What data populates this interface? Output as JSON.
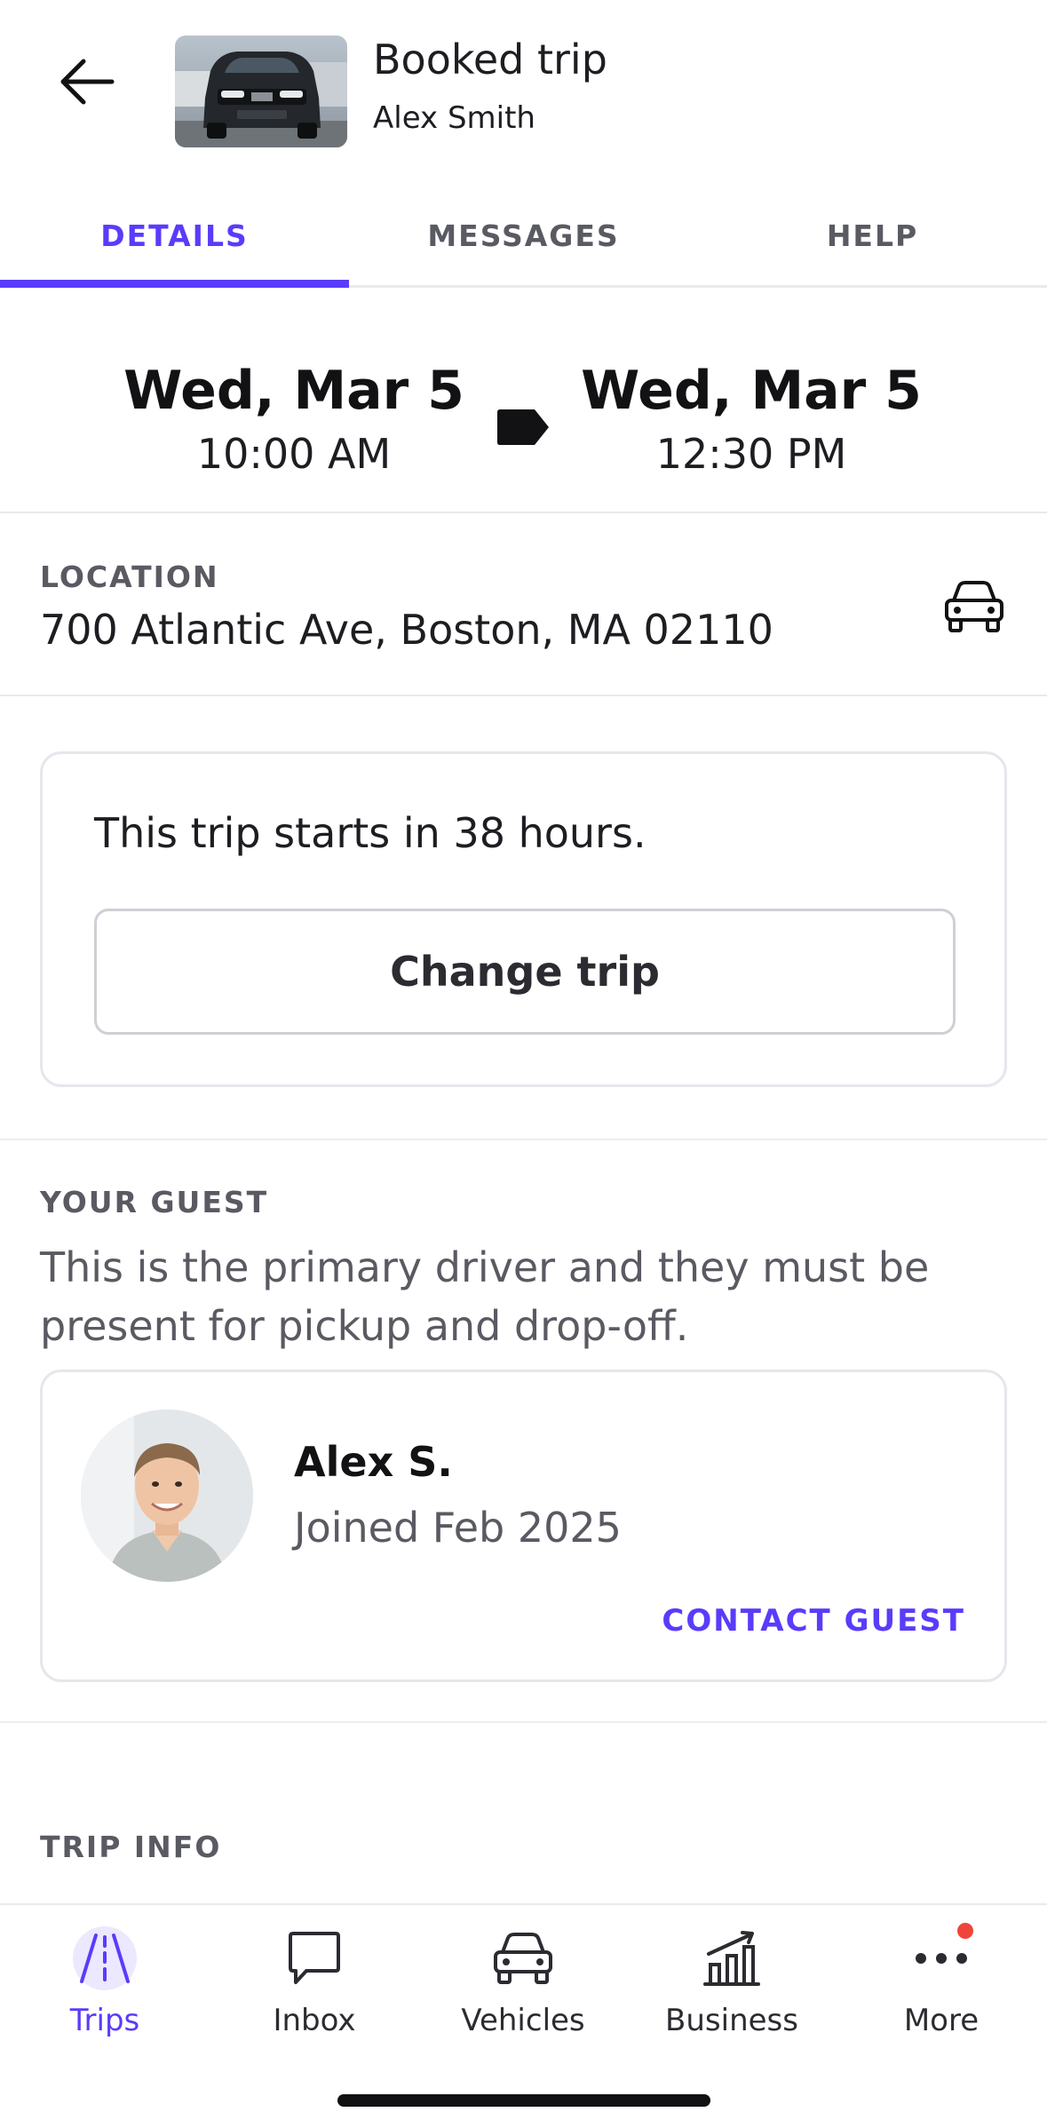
{
  "header": {
    "title": "Booked trip",
    "subtitle": "Alex Smith"
  },
  "tabs": [
    {
      "label": "DETAILS",
      "active": true
    },
    {
      "label": "MESSAGES",
      "active": false
    },
    {
      "label": "HELP",
      "active": false
    }
  ],
  "trip_dates": {
    "start": {
      "day": "Wed, Mar 5",
      "time": "10:00 AM"
    },
    "end": {
      "day": "Wed, Mar 5",
      "time": "12:30 PM"
    }
  },
  "location": {
    "label": "LOCATION",
    "address": "700 Atlantic Ave, Boston, MA 02110"
  },
  "trip_status": {
    "message": "This trip starts in 38 hours.",
    "change_button": "Change trip"
  },
  "guest": {
    "label": "YOUR GUEST",
    "description": "This is the primary driver and they must be present for pickup and drop-off.",
    "name": "Alex S.",
    "joined": "Joined Feb 2025",
    "contact_label": "CONTACT GUEST"
  },
  "trip_info": {
    "label": "TRIP INFO"
  },
  "bottom_nav": [
    {
      "label": "Trips",
      "icon": "road-icon",
      "active": true
    },
    {
      "label": "Inbox",
      "icon": "chat-bubble-icon",
      "active": false
    },
    {
      "label": "Vehicles",
      "icon": "car-icon",
      "active": false
    },
    {
      "label": "Business",
      "icon": "chart-icon",
      "active": false
    },
    {
      "label": "More",
      "icon": "more-dots-icon",
      "active": false,
      "has_notification": true
    }
  ],
  "colors": {
    "accent": "#593cfb",
    "text": "#1d1d22",
    "muted": "#5a5a63",
    "border": "#e6e6ec",
    "notification": "#f0443a"
  }
}
